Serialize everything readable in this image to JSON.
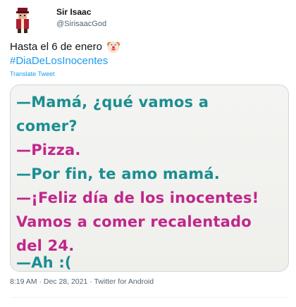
{
  "author": {
    "display_name": "Sir Isaac",
    "handle": "@SirisaacGod",
    "avatar_icon": "avatar-figure-icon"
  },
  "tweet": {
    "text": "Hasta el 6 de enero",
    "emoji_icon": "clown-face-icon",
    "hashtag": "#DiaDeLosInocentes",
    "translate_label": "Translate Tweet"
  },
  "media": {
    "lines": [
      {
        "text": "—Mamá, ¿qué vamos a",
        "color": "#1b8e92"
      },
      {
        "text": "comer?",
        "color": "#1b8e92"
      },
      {
        "text": "—Pizza.",
        "color": "#c0278b"
      },
      {
        "text": "—Por fin, te amo mamá.",
        "color": "#1b8e92"
      },
      {
        "text": "—¡Feliz día de los inocentes!",
        "color": "#c0278b"
      },
      {
        "text": "Vamos a comer recalentado",
        "color": "#c0278b"
      },
      {
        "text": "del 24.",
        "color": "#c0278b"
      },
      {
        "text": "—Ah :(",
        "color": "#1b8e92"
      }
    ]
  },
  "footer": {
    "meta": "8:19 AM · Dec 28, 2021 · Twitter for Android"
  },
  "colors": {
    "link": "#1d9bf0",
    "secondary_text": "#536471",
    "teal_text": "#1b8e92",
    "magenta_text": "#c0278b"
  }
}
